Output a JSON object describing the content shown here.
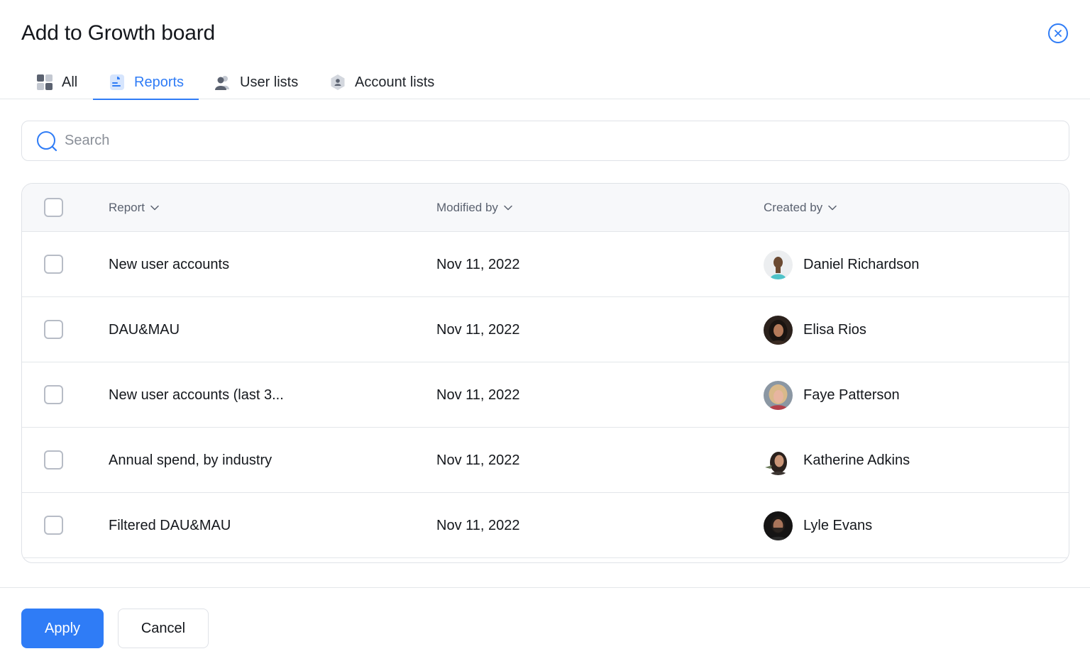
{
  "dialog": {
    "title": "Add to Growth board",
    "accent_color": "#2f7cf6"
  },
  "tabs": [
    {
      "label": "All",
      "icon": "grid-icon",
      "active": false
    },
    {
      "label": "Reports",
      "icon": "report-icon",
      "active": true
    },
    {
      "label": "User lists",
      "icon": "users-icon",
      "active": false
    },
    {
      "label": "Account lists",
      "icon": "account-icon",
      "active": false
    }
  ],
  "search": {
    "placeholder": "Search",
    "value": ""
  },
  "table": {
    "columns": [
      "Report",
      "Modified by",
      "Created by"
    ],
    "rows": [
      {
        "report": "New user accounts",
        "modified": "Nov 11, 2022",
        "creator": "Daniel Richardson",
        "checked": false
      },
      {
        "report": "DAU&MAU",
        "modified": "Nov 11, 2022",
        "creator": "Elisa Rios",
        "checked": false
      },
      {
        "report": "New user accounts (last 3...",
        "modified": "Nov 11, 2022",
        "creator": "Faye Patterson",
        "checked": false
      },
      {
        "report": "Annual spend, by industry",
        "modified": "Nov 11, 2022",
        "creator": "Katherine Adkins",
        "checked": false
      },
      {
        "report": "Filtered DAU&MAU",
        "modified": "Nov 11, 2022",
        "creator": "Lyle Evans",
        "checked": false
      }
    ]
  },
  "footer": {
    "apply_label": "Apply",
    "cancel_label": "Cancel"
  }
}
